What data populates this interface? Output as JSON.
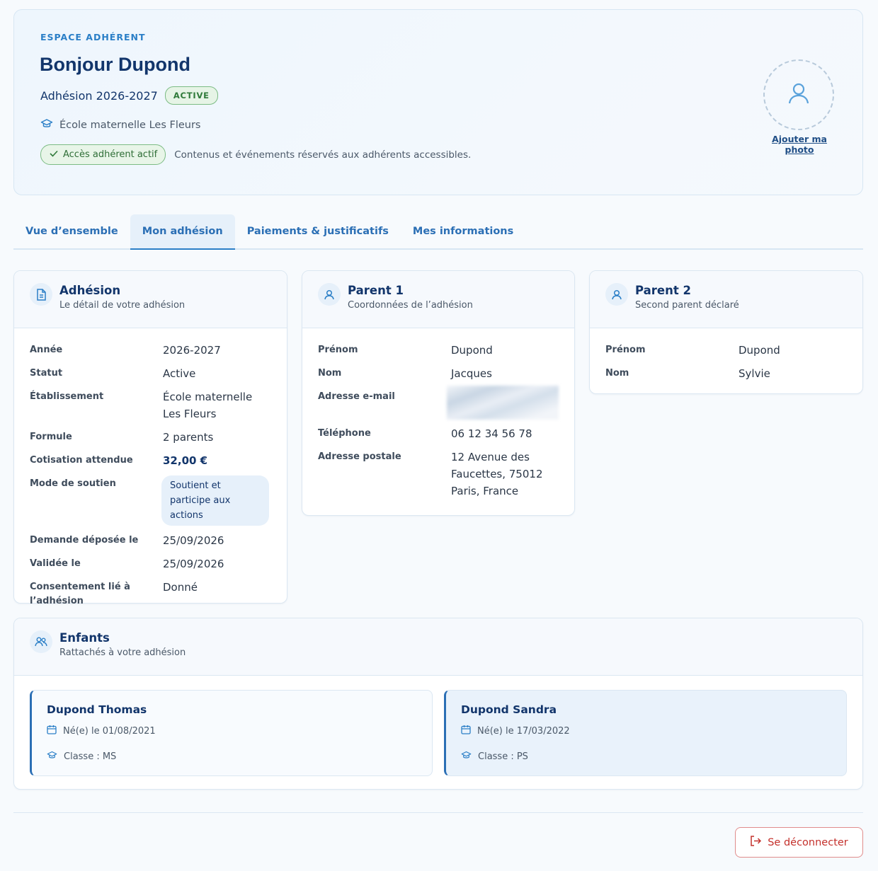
{
  "hero": {
    "kicker": "ESPACE ADHÉRENT",
    "greeting": "Bonjour Dupond",
    "season": "Adhésion 2026-2027",
    "status_badge": "ACTIVE",
    "school": "École maternelle Les Fleurs",
    "access_label": "Accès adhérent actif",
    "access_text": "Contenus et événements réservés aux adhérents accessibles.",
    "add_photo": "Ajouter ma photo"
  },
  "tabs": [
    {
      "label": "Vue d’ensemble"
    },
    {
      "label": "Mon adhésion"
    },
    {
      "label": "Paiements & justificatifs"
    },
    {
      "label": "Mes informations"
    }
  ],
  "adhesion": {
    "title": "Adhésion",
    "subtitle": "Le détail de votre adhésion",
    "rows": [
      {
        "label": "Année",
        "value": "2026-2027"
      },
      {
        "label": "Statut",
        "value": "Active"
      },
      {
        "label": "Établissement",
        "value": "École maternelle Les Fleurs"
      },
      {
        "label": "Formule",
        "value": "2 parents"
      },
      {
        "label": "Cotisation attendue",
        "value": "32,00 €"
      },
      {
        "label": "Mode de soutien",
        "value": "Soutient et participe aux actions"
      },
      {
        "label": "Demande déposée le",
        "value": "25/09/2026"
      },
      {
        "label": "Validée le",
        "value": "25/09/2026"
      },
      {
        "label": "Consentement lié à l’adhésion",
        "value": "Donné"
      }
    ]
  },
  "parent1": {
    "title": "Parent 1",
    "subtitle": "Coordonnées de l’adhésion",
    "rows": [
      {
        "label": "Prénom",
        "value": "Dupond"
      },
      {
        "label": "Nom",
        "value": "Jacques"
      },
      {
        "label": "Adresse e-mail",
        "value": ""
      },
      {
        "label": "Téléphone",
        "value": "06 12 34 56 78"
      },
      {
        "label": "Adresse postale",
        "value": "12 Avenue des Faucettes, 75012 Paris, France"
      }
    ]
  },
  "parent2": {
    "title": "Parent 2",
    "subtitle": "Second parent déclaré",
    "rows": [
      {
        "label": "Prénom",
        "value": "Dupond"
      },
      {
        "label": "Nom",
        "value": "Sylvie"
      }
    ]
  },
  "children": {
    "title": "Enfants",
    "subtitle": "Rattachés à votre adhésion",
    "items": [
      {
        "name": "Dupond Thomas",
        "birth": "Né(e) le 01/08/2021",
        "class": "Classe : MS"
      },
      {
        "name": "Dupond Sandra",
        "birth": "Né(e) le 17/03/2022",
        "class": "Classe : PS"
      }
    ]
  },
  "footer": {
    "logout": "Se déconnecter"
  },
  "colors": {
    "primary": "#12356b",
    "accent": "#2b7fc7",
    "success": "#2f7a3a",
    "danger": "#c4302b"
  }
}
